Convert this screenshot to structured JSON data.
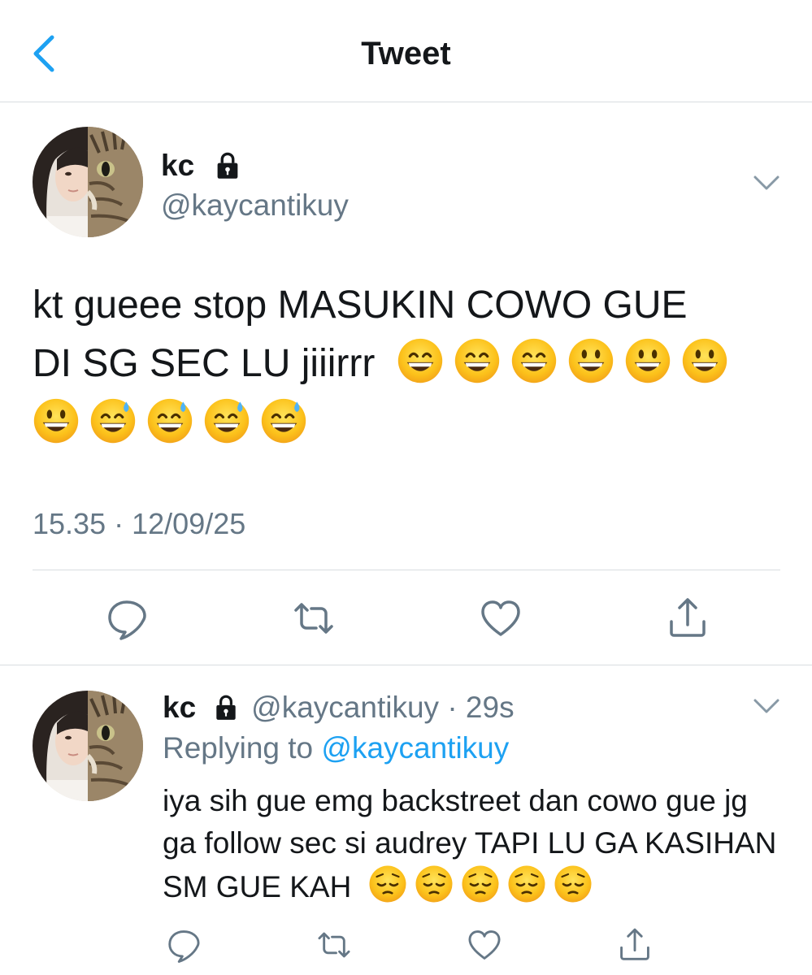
{
  "header": {
    "title": "Tweet",
    "back_icon": "chevron-left-icon"
  },
  "colors": {
    "accent": "#1da1f2",
    "secondary_text": "#657786",
    "divider": "#d8dde1"
  },
  "tweet": {
    "display_name": "kc",
    "handle": "@kaycantikuy",
    "protected": true,
    "text_line1": "kt gueee stop MASUKIN COWO GUE",
    "text_line2": "DI SG SEC LU jiiirrr",
    "emojis": [
      "grinning-smiling-eyes",
      "grinning-smiling-eyes",
      "grinning-smiling-eyes",
      "grinning-big-eyes",
      "grinning-big-eyes",
      "grinning-big-eyes",
      "grinning-big-eyes",
      "grinning-sweat",
      "grinning-sweat",
      "grinning-sweat",
      "grinning-sweat"
    ],
    "time": "15.35",
    "date": "12/09/25",
    "separator": "·",
    "actions": [
      "reply-icon",
      "retweet-icon",
      "like-icon",
      "share-icon"
    ]
  },
  "reply": {
    "display_name": "kc",
    "handle": "@kaycantikuy",
    "separator": "·",
    "age": "29s",
    "replying_prefix": "Replying to",
    "replying_handle": "@kaycantikuy",
    "text": "iya sih gue emg backstreet dan cowo gue jg ga follow sec si audrey TAPI LU GA KASIHAN SM GUE KAH",
    "emojis": [
      "pensive",
      "pensive",
      "pensive",
      "pensive",
      "pensive"
    ],
    "actions": [
      "reply-icon",
      "retweet-icon",
      "like-icon",
      "share-icon"
    ]
  }
}
